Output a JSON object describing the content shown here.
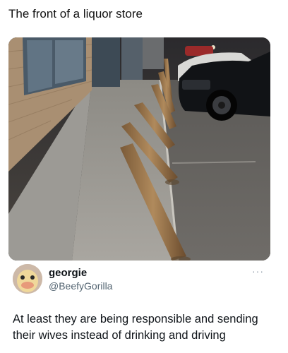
{
  "post": {
    "caption": "The front of a liquor store",
    "image": {
      "description_icon": "photo-storefront-bollards"
    },
    "author": {
      "display_name": "georgie",
      "handle": "@BeefyGorilla",
      "avatar_icon": "duck-face-avatar"
    },
    "more_icon": "ellipsis-icon",
    "more_label": "···",
    "text": "At least they are being responsible and sending their wives instead of drinking and driving"
  }
}
